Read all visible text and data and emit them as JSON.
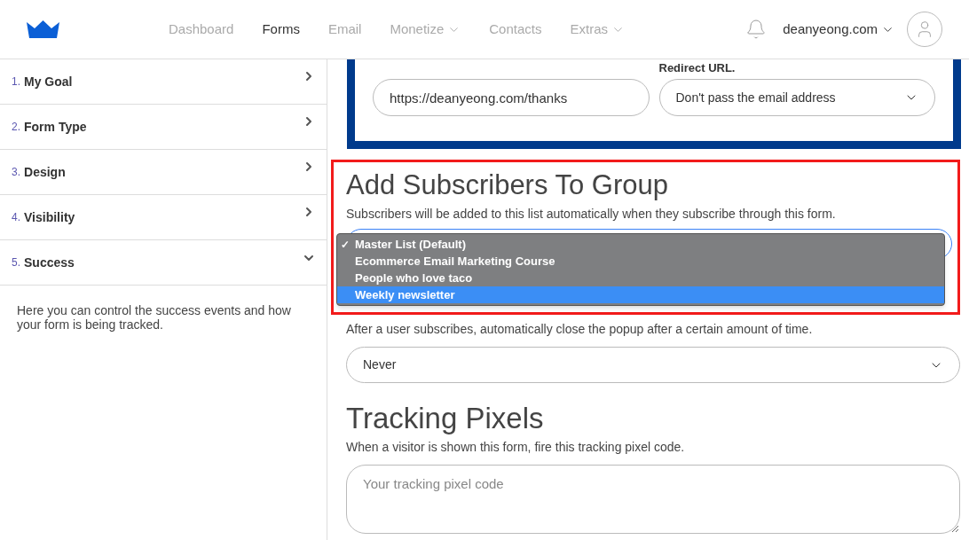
{
  "nav": {
    "items": [
      {
        "label": "Dashboard",
        "selected": false,
        "has_menu": false
      },
      {
        "label": "Forms",
        "selected": true,
        "has_menu": false
      },
      {
        "label": "Email",
        "selected": false,
        "has_menu": false
      },
      {
        "label": "Monetize",
        "selected": false,
        "has_menu": true
      },
      {
        "label": "Contacts",
        "selected": false,
        "has_menu": false
      },
      {
        "label": "Extras",
        "selected": false,
        "has_menu": true
      }
    ],
    "account": "deanyeong.com"
  },
  "sidebar": {
    "items": [
      {
        "number": "1.",
        "label": "My Goal",
        "expanded": false
      },
      {
        "number": "2.",
        "label": "Form Type",
        "expanded": false
      },
      {
        "number": "3.",
        "label": "Design",
        "expanded": false
      },
      {
        "number": "4.",
        "label": "Visibility",
        "expanded": false
      },
      {
        "number": "5.",
        "label": "Success",
        "expanded": true
      }
    ],
    "description": "Here you can control the success events and how your form is being tracked."
  },
  "redirect_card": {
    "url_value": "https://deanyeong.com/thanks",
    "select_label": "Redirect URL.",
    "select_value": "Don't pass the email address"
  },
  "subscribers_group": {
    "title": "Add Subscribers To Group",
    "description": "Subscribers will be added to this list automatically when they subscribe through this form.",
    "options": [
      {
        "label": "Master List (Default)",
        "checked": true,
        "selected": false
      },
      {
        "label": "Ecommerce Email Marketing Course",
        "checked": false,
        "selected": false
      },
      {
        "label": "People who love taco",
        "checked": false,
        "selected": false
      },
      {
        "label": "Weekly newsletter",
        "checked": false,
        "selected": true
      }
    ],
    "check_mark": "✓"
  },
  "auto_close": {
    "description": "After a user subscribes, automatically close the popup after a certain amount of time.",
    "value": "Never"
  },
  "tracking_pixels": {
    "title": "Tracking Pixels",
    "description": "When a visitor is shown this form, fire this tracking pixel code.",
    "placeholder": "Your tracking pixel code"
  }
}
